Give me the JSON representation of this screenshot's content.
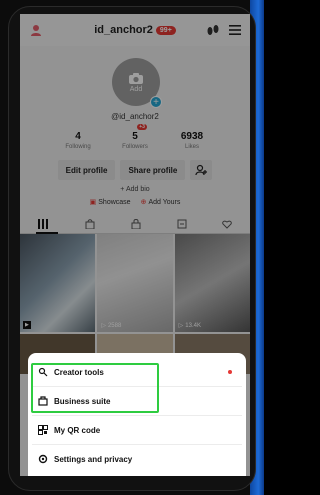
{
  "header": {
    "username": "id_anchor2",
    "badge": "99+"
  },
  "profile": {
    "avatar_label": "Add",
    "handle": "@id_anchor2",
    "stats": [
      {
        "num": "4",
        "label": "Following"
      },
      {
        "num": "5",
        "label": "Followers",
        "badge": "+3"
      },
      {
        "num": "6938",
        "label": "Likes"
      }
    ],
    "edit_button": "Edit profile",
    "share_button": "Share profile",
    "add_bio": "+ Add bio",
    "showcase": "Showcase",
    "add_yours": "Add Yours"
  },
  "grid": {
    "tiles": [
      {
        "views": ""
      },
      {
        "views": "2588"
      },
      {
        "views": "13.4K"
      }
    ]
  },
  "menu": {
    "items": [
      {
        "label": "Creator tools",
        "icon": "creator-tools-icon"
      },
      {
        "label": "Business suite",
        "icon": "business-suite-icon"
      },
      {
        "label": "My QR code",
        "icon": "qr-code-icon"
      },
      {
        "label": "Settings and privacy",
        "icon": "settings-gear-icon"
      }
    ]
  },
  "colors": {
    "highlight": "#2ecc40",
    "badge_red": "#e53935",
    "accent_blue": "#26a6d4"
  }
}
